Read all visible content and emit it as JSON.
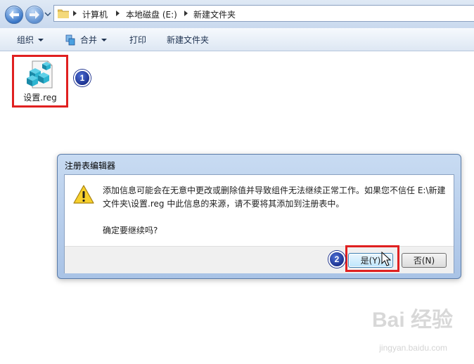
{
  "address_bar": {
    "breadcrumbs": [
      "计算机",
      "本地磁盘 (E:)",
      "新建文件夹"
    ]
  },
  "toolbar": {
    "organize_label": "组织",
    "merge_label": "合并",
    "print_label": "打印",
    "new_folder_label": "新建文件夹"
  },
  "file": {
    "name": "设置.reg",
    "icon": "registry-file-icon"
  },
  "annotations": {
    "step1": "1",
    "step2": "2"
  },
  "dialog": {
    "title": "注册表编辑器",
    "message": "添加信息可能会在无意中更改或删除值并导致组件无法继续正常工作。如果您不信任 E:\\新建文件夹\\设置.reg 中此信息的来源，请不要将其添加到注册表中。",
    "confirm": "确定要继续吗?",
    "yes_label": "是(Y)",
    "no_label": "否(N)",
    "icon": "warning-icon"
  },
  "watermark": {
    "text": "Bai 经验",
    "sub": "jingyan.baidu.com"
  },
  "colors": {
    "highlight": "#e02020",
    "badge": "#1a2f8c"
  }
}
